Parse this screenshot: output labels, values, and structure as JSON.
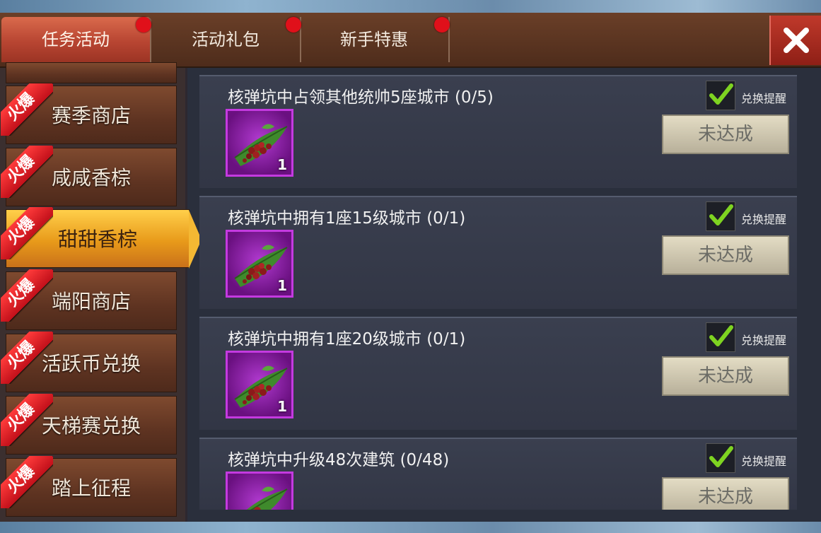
{
  "tabs": [
    {
      "label": "任务活动",
      "active": true,
      "badge": true
    },
    {
      "label": "活动礼包",
      "active": false,
      "badge": true
    },
    {
      "label": "新手特惠",
      "active": false,
      "badge": true
    }
  ],
  "close_icon": "close-icon",
  "sidebar": {
    "hot_badge": "火爆",
    "items": [
      {
        "label": "赛季商店",
        "active": false
      },
      {
        "label": "咸咸香棕",
        "active": false
      },
      {
        "label": "甜甜香棕",
        "active": true
      },
      {
        "label": "端阳商店",
        "active": false
      },
      {
        "label": "活跃币兑换",
        "active": false
      },
      {
        "label": "天梯赛兑换",
        "active": false
      },
      {
        "label": "踏上征程",
        "active": false
      }
    ]
  },
  "tasks": [
    {
      "title": "核弹坑中占领其他统帅5座城市  (0/5)",
      "reward_qty": "1",
      "remind_label": "兑换提醒",
      "remind_checked": true,
      "status": "未达成"
    },
    {
      "title": "核弹坑中拥有1座15级城市  (0/1)",
      "reward_qty": "1",
      "remind_label": "兑换提醒",
      "remind_checked": true,
      "status": "未达成"
    },
    {
      "title": "核弹坑中拥有1座20级城市  (0/1)",
      "reward_qty": "1",
      "remind_label": "兑换提醒",
      "remind_checked": true,
      "status": "未达成"
    },
    {
      "title": "核弹坑中升级48次建筑  (0/48)",
      "reward_qty": "",
      "remind_label": "兑换提醒",
      "remind_checked": true,
      "status": "未达成"
    }
  ],
  "colors": {
    "accent_tab": "#b84532",
    "active_item": "#e89a1a",
    "check": "#7ed321",
    "reward_frame": "#c43ae0"
  }
}
